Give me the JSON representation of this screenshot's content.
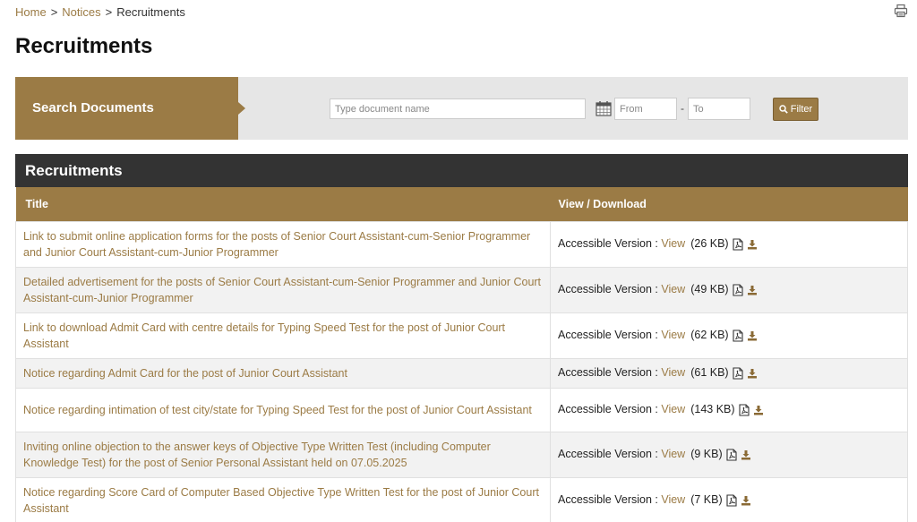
{
  "breadcrumb": {
    "home": "Home",
    "sep": ">",
    "notices": "Notices",
    "current": "Recruitments"
  },
  "page_title": "Recruitments",
  "search": {
    "label": "Search Documents",
    "doc_placeholder": "Type document name",
    "from_placeholder": "From",
    "to_placeholder": "To",
    "dash": "-",
    "filter_label": "Filter"
  },
  "section_title": "Recruitments",
  "table": {
    "headers": {
      "title": "Title",
      "view": "View / Download"
    },
    "rows": [
      {
        "title": "Link to submit online application forms for the posts of Senior Court Assistant-cum-Senior Programmer and Junior Court Assistant-cum-Junior Programmer",
        "accessible": "Accessible Version :",
        "view": "View",
        "size": "(26 KB)"
      },
      {
        "title": "Detailed advertisement for the posts of Senior Court Assistant-cum-Senior Programmer and Junior Court Assistant-cum-Junior Programmer",
        "accessible": "Accessible Version :",
        "view": "View",
        "size": "(49 KB)"
      },
      {
        "title": "Link to download Admit Card with centre details for Typing Speed Test for the post of Junior Court Assistant",
        "accessible": "Accessible Version :",
        "view": "View",
        "size": "(62 KB)"
      },
      {
        "title": "Notice regarding Admit Card for the post of Junior Court Assistant",
        "accessible": "Accessible Version :",
        "view": "View",
        "size": "(61 KB)"
      },
      {
        "title": "Notice regarding intimation of test city/state for Typing Speed Test for the post of Junior Court Assistant",
        "accessible": "Accessible Version :",
        "view": "View",
        "size": "(143 KB)"
      },
      {
        "title": "Inviting online objection to the answer keys of Objective Type Written Test (including Computer Knowledge Test) for the post of Senior Personal Assistant held on 07.05.2025",
        "accessible": "Accessible Version :",
        "view": "View",
        "size": "(9 KB)"
      },
      {
        "title": "Notice regarding Score Card of Computer Based Objective Type Written Test for the post of Junior Court Assistant",
        "accessible": "Accessible Version :",
        "view": "View",
        "size": "(7 KB)"
      }
    ]
  },
  "colors": {
    "accent": "#9b7b45",
    "header_dark": "#333333",
    "search_bg": "#e6e6e6"
  },
  "icons": {
    "print": "printer-icon",
    "calendar": "calendar-icon",
    "filter": "search-icon",
    "pdf": "pdf-icon",
    "download": "download-icon"
  }
}
